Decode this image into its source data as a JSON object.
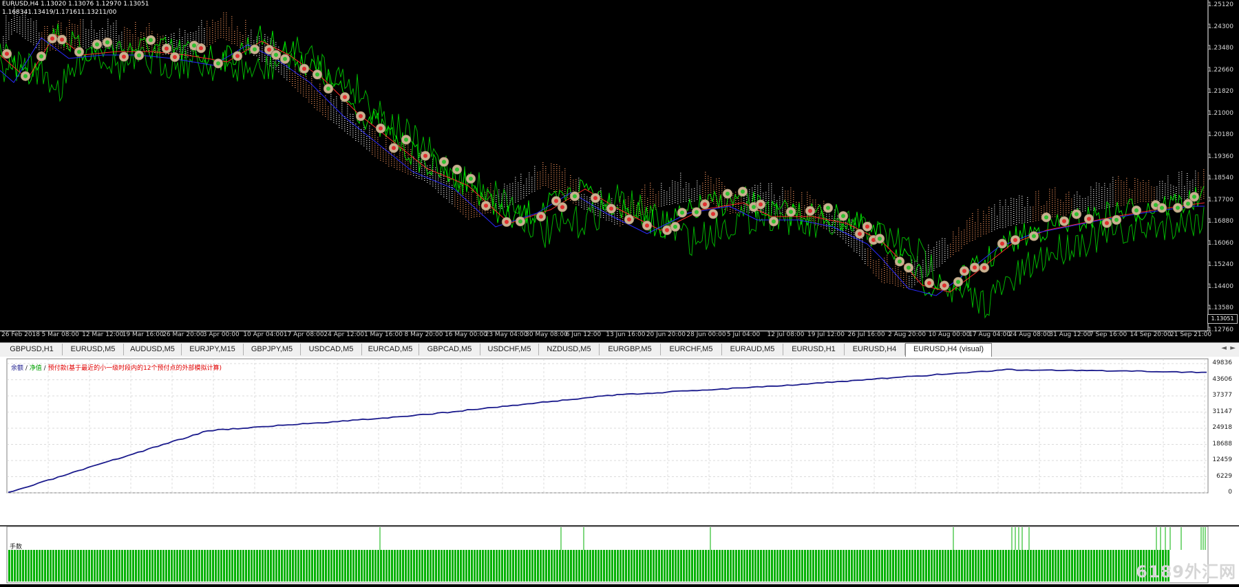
{
  "chart": {
    "symbol_line": "EURUSD,H4  1.13020 1.13076 1.12970 1.13051",
    "indicator_line": "1.168341.13419/1.171611.13211/00",
    "current_price_label": "1.13051",
    "price_ticks": [
      "1.25120",
      "1.24300",
      "1.23480",
      "1.22660",
      "1.21820",
      "1.21000",
      "1.20180",
      "1.19360",
      "1.18540",
      "1.17700",
      "1.16880",
      "1.16060",
      "1.15240",
      "1.14400",
      "1.13580",
      "1.12760"
    ],
    "time_ticks": [
      "26 Feb 2018",
      "5 Mar 08:00",
      "12 Mar 12:00",
      "19 Mar 16:00",
      "26 Mar 20:00",
      "3 Apr 00:00",
      "10 Apr 04:00",
      "17 Apr 08:00",
      "24 Apr 12:00",
      "1 May 16:00",
      "8 May 20:00",
      "16 May 00:00",
      "23 May 04:00",
      "30 May 08:00",
      "6 Jun 12:00",
      "13 Jun 16:00",
      "20 Jun 20:00",
      "28 Jun 00:00",
      "5 Jul 04:00",
      "12 Jul 08:00",
      "19 Jul 12:00",
      "26 Jul 16:00",
      "2 Aug 20:00",
      "10 Aug 00:00",
      "17 Aug 04:00",
      "24 Aug 08:00",
      "31 Aug 12:00",
      "7 Sep 16:00",
      "14 Sep 20:00",
      "21 Sep 21:00"
    ],
    "colors": {
      "price_line": "#00e000",
      "ma_red": "#ff2a2a",
      "ma_blue": "#2a2aff",
      "cloud_a": "#ffffff",
      "cloud_b": "#ff9a60",
      "marker": "#c8b090"
    }
  },
  "tabs": [
    {
      "label": "GBPUSD,H1",
      "active": false
    },
    {
      "label": "EURUSD,M5",
      "active": false
    },
    {
      "label": "AUDUSD,M5",
      "active": false
    },
    {
      "label": "EURJPY,M15",
      "active": false
    },
    {
      "label": "GBPJPY,M5",
      "active": false
    },
    {
      "label": "USDCAD,M5",
      "active": false
    },
    {
      "label": "EURCAD,M5",
      "active": false
    },
    {
      "label": "GBPCAD,M5",
      "active": false
    },
    {
      "label": "USDCHF,M5",
      "active": false
    },
    {
      "label": "NZDUSD,M5",
      "active": false
    },
    {
      "label": "EURGBP,M5",
      "active": false
    },
    {
      "label": "EURCHF,M5",
      "active": false
    },
    {
      "label": "EURAUD,M5",
      "active": false
    },
    {
      "label": "EURUSD,H1",
      "active": false
    },
    {
      "label": "EURUSD,H4",
      "active": false
    },
    {
      "label": "EURUSD,H4 (visual)",
      "active": true
    }
  ],
  "tab_nav": {
    "left": "◄",
    "right": "►"
  },
  "equity": {
    "legend_balance": "余额",
    "legend_sep1": " / ",
    "legend_equity": "净值",
    "legend_sep2": " / ",
    "legend_margin": "预付款(基于最近的小一级时段内的12个预付点的外部模拟计算)",
    "ticks": [
      "49836",
      "43606",
      "37377",
      "31147",
      "24918",
      "18688",
      "12459",
      "6229",
      "0"
    ],
    "line_color": "#1a1a8c",
    "lots_label": "手数",
    "lots_bar_color": "#00b000"
  },
  "watermark": "6189外汇网",
  "chart_data": {
    "type": "line",
    "title": "",
    "xlabel": "",
    "ylabel": "",
    "ylim": [
      0,
      49836
    ],
    "x": [
      "26 Feb 2018",
      "16 May 00:00",
      "5 Jul 04:00",
      "26 Jul 16:00",
      "24 Aug 08:00",
      "7 Sep 16:00",
      "21 Sep 21:00"
    ],
    "series": [
      {
        "name": "余额",
        "values": [
          0,
          24000,
          29500,
          37500,
          42000,
          47500,
          46500
        ]
      }
    ]
  }
}
